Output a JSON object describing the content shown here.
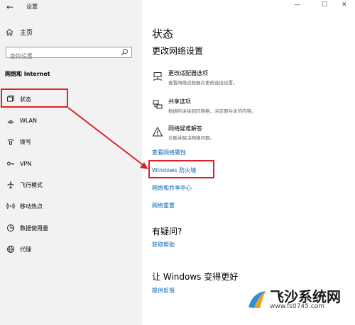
{
  "window": {
    "back_glyph": "←",
    "title": "设置",
    "minimize_glyph": "—",
    "maximize_glyph": "☐",
    "close_glyph": "✕"
  },
  "sidebar": {
    "home_label": "主页",
    "search_placeholder": "查找设置",
    "section_title": "网络和 Internet",
    "items": [
      {
        "label": "状态",
        "icon": "globe-icon",
        "active": true
      },
      {
        "label": "WLAN",
        "icon": "wifi-icon"
      },
      {
        "label": "拨号",
        "icon": "dialup-icon"
      },
      {
        "label": "VPN",
        "icon": "vpn-icon"
      },
      {
        "label": "飞行模式",
        "icon": "airplane-icon"
      },
      {
        "label": "移动热点",
        "icon": "hotspot-icon"
      },
      {
        "label": "数据使用量",
        "icon": "data-usage-icon"
      },
      {
        "label": "代理",
        "icon": "proxy-globe-icon"
      }
    ]
  },
  "main": {
    "title": "状态",
    "subtitle": "更改网络设置",
    "options": [
      {
        "title": "更改适配器选项",
        "desc": "查看网络适配器并更改连接设置。",
        "icon": "adapter-icon"
      },
      {
        "title": "共享选项",
        "desc": "根据所连接到的网络，决定要共享的内容。",
        "icon": "sharing-icon"
      },
      {
        "title": "网络疑难解答",
        "desc": "诊断并解决网络问题。",
        "icon": "warning-icon"
      }
    ],
    "links": [
      "查看网络属性",
      "Windows 防火墙",
      "网络和共享中心",
      "网络重置"
    ],
    "question_heading": "有疑问?",
    "help_link": "获取帮助",
    "improve_heading": "让 Windows 变得更好",
    "feedback_link": "提供反馈"
  },
  "watermark": {
    "text": "飞沙系统网",
    "url": "www.fs0745.com"
  },
  "colors": {
    "accent_link": "#0064b4",
    "highlight": "#d9232b",
    "sidebar_bg": "#f2f2f2"
  }
}
